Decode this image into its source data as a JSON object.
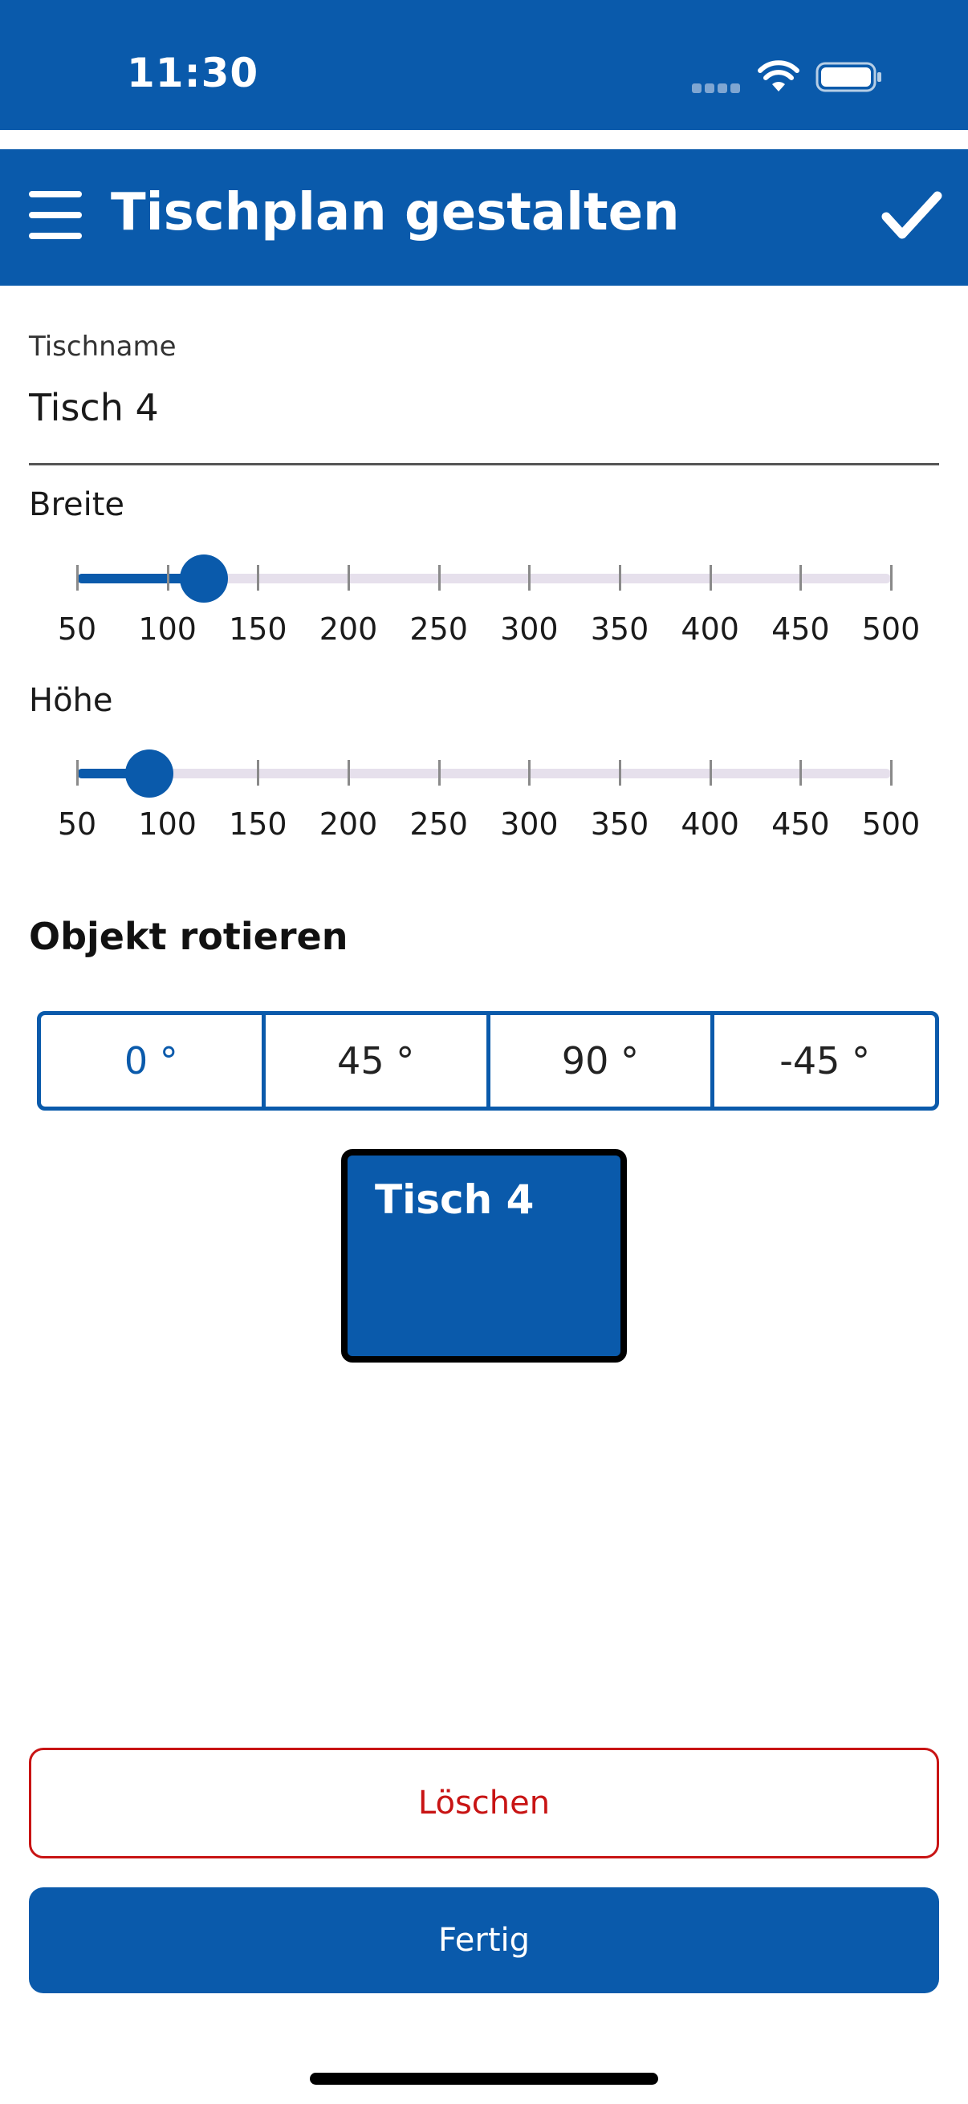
{
  "status_bar": {
    "time": "11:30",
    "icons": [
      "cellular-signal-icon",
      "wifi-icon",
      "battery-icon"
    ]
  },
  "app_bar": {
    "title": "Tischplan gestalten",
    "menu_icon": "hamburger-menu-icon",
    "confirm_icon": "checkmark-icon"
  },
  "table_name_field": {
    "label": "Tischname",
    "value": "Tisch 4"
  },
  "width_slider": {
    "label": "Breite",
    "min": 50,
    "max": 500,
    "value": 120,
    "ticks": [
      "50",
      "100",
      "150",
      "200",
      "250",
      "300",
      "350",
      "400",
      "450",
      "500"
    ]
  },
  "height_slider": {
    "label": "Höhe",
    "min": 50,
    "max": 500,
    "value": 90,
    "ticks": [
      "50",
      "100",
      "150",
      "200",
      "250",
      "300",
      "350",
      "400",
      "450",
      "500"
    ]
  },
  "rotation": {
    "title": "Objekt rotieren",
    "options": [
      "0 °",
      "45 °",
      "90 °",
      "-45 °"
    ],
    "selected": "0 °"
  },
  "preview": {
    "table_label": "Tisch 4"
  },
  "actions": {
    "delete_label": "Löschen",
    "done_label": "Fertig"
  },
  "colors": {
    "primary": "#0a5aab",
    "danger": "#c81414",
    "track": "#e6e0ec"
  }
}
